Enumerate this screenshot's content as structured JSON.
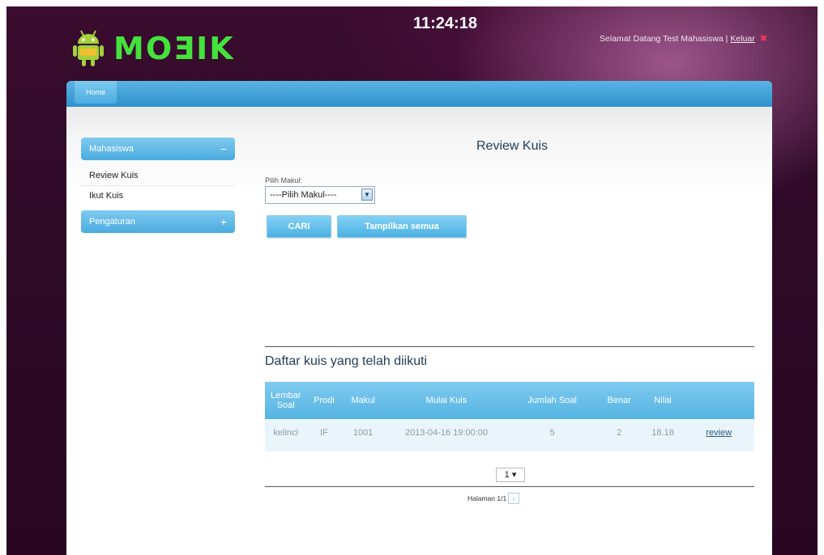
{
  "header": {
    "logo_text": "MOƎIK",
    "clock": "11:24:18",
    "welcome_text": "Selamat Datang Test Mahasiswa |",
    "logout_label": "Keluar"
  },
  "nav": {
    "home_label": "Home"
  },
  "sidebar": {
    "sections": [
      {
        "label": "Mahasiswa",
        "sign": "−",
        "items": [
          "Review Kuis",
          "Ikut Kuis"
        ]
      },
      {
        "label": "Pengaturan",
        "sign": "+",
        "items": []
      }
    ]
  },
  "main": {
    "title": "Review Kuis",
    "makul_label": "Pilih Makul:",
    "makul_selected": "----Pilih Makul----",
    "search_button": "CARI",
    "show_all_button": "Tampilkan semua",
    "list_title": "Daftar kuis yang telah diikuti"
  },
  "table": {
    "columns": [
      "Lembar Soal",
      "Prodi",
      "Makul",
      "Mulai Kuis",
      "Jumlah Soal",
      "Benar",
      "Nilai",
      ""
    ],
    "rows": [
      [
        "kelinci",
        "IF",
        "1001",
        "2013-04-16 19:00:00",
        "5",
        "2",
        "18.18",
        "review"
      ]
    ]
  },
  "pagination": {
    "page_select": "1 ▾",
    "page_text": "Halaman 1/1",
    "next_label": "›"
  },
  "colors": {
    "accent_blue": "#4cacdf",
    "logo_green": "#43e23c",
    "background": "#2e0a27"
  }
}
